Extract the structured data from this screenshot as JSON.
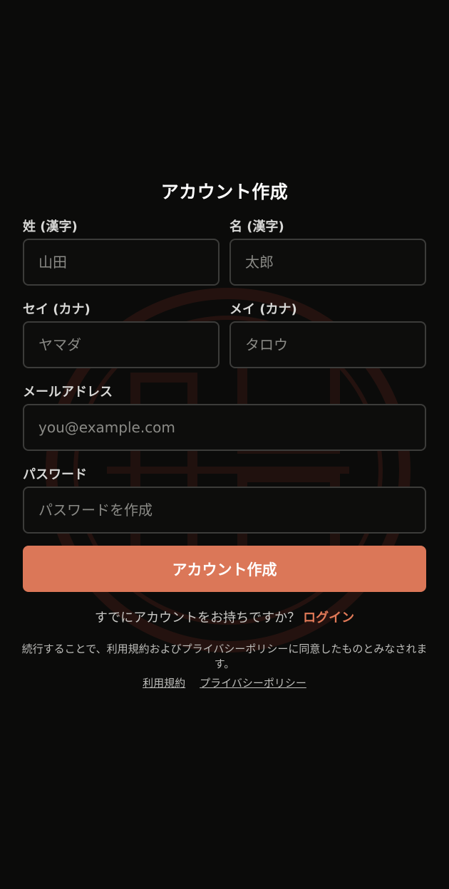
{
  "form": {
    "title": "アカウント作成",
    "last_name": {
      "label": "姓 (漢字)",
      "placeholder": "山田",
      "value": ""
    },
    "first_name": {
      "label": "名 (漢字)",
      "placeholder": "太郎",
      "value": ""
    },
    "last_name_kana": {
      "label": "セイ (カナ)",
      "placeholder": "ヤマダ",
      "value": ""
    },
    "first_name_kana": {
      "label": "メイ (カナ)",
      "placeholder": "タロウ",
      "value": ""
    },
    "email": {
      "label": "メールアドレス",
      "placeholder": "you@example.com",
      "value": ""
    },
    "password": {
      "label": "パスワード",
      "placeholder": "パスワードを作成",
      "value": ""
    },
    "submit_label": "アカウント作成"
  },
  "login_prompt": {
    "text": "すでにアカウントをお持ちですか？",
    "link_label": "ログイン"
  },
  "legal": {
    "consent_text": "続行することで、利用規約およびプライバシーポリシーに同意したものとみなされます。",
    "terms_label": "利用規約",
    "privacy_label": "プライバシーポリシー"
  },
  "icons": {
    "watermark": "circular-logo-watermark"
  },
  "colors": {
    "background": "#0b0b0a",
    "accent": "#db7758",
    "link": "#e27a58",
    "field_border": "#3c3c3a"
  }
}
